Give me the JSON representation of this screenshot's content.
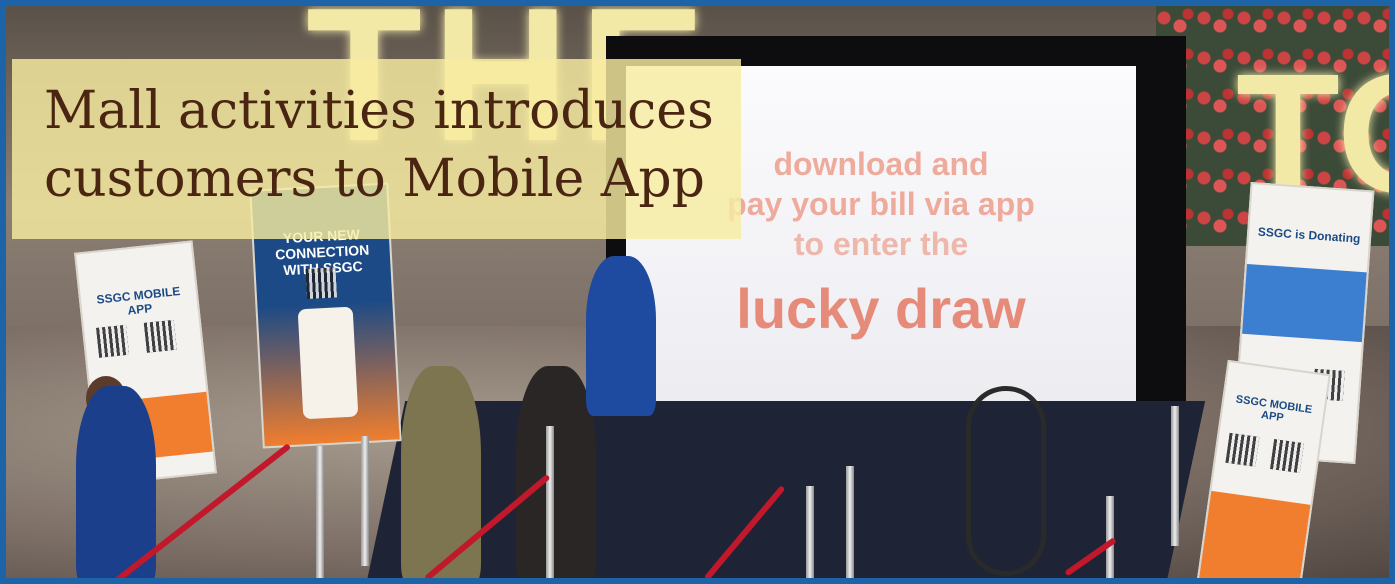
{
  "headline": {
    "line1": "Mall activities introduces",
    "line2": "customers to Mobile App"
  },
  "screen_text": {
    "line1": "download and",
    "line2": "pay your bill via app",
    "line3": "to enter the",
    "line4": "lucky draw"
  },
  "standees": {
    "left_title": "SSGC MOBILE APP",
    "center_title": "YOUR NEW CONNECTION WITH SSGC",
    "right_title": "SSGC is Donating",
    "right_bottom_title": "SSGC MOBILE APP"
  },
  "colors": {
    "frame_border": "#1d63a8",
    "headline_box": "#f7eba0",
    "headline_text": "#4a2512",
    "rope": "#c2182b"
  }
}
